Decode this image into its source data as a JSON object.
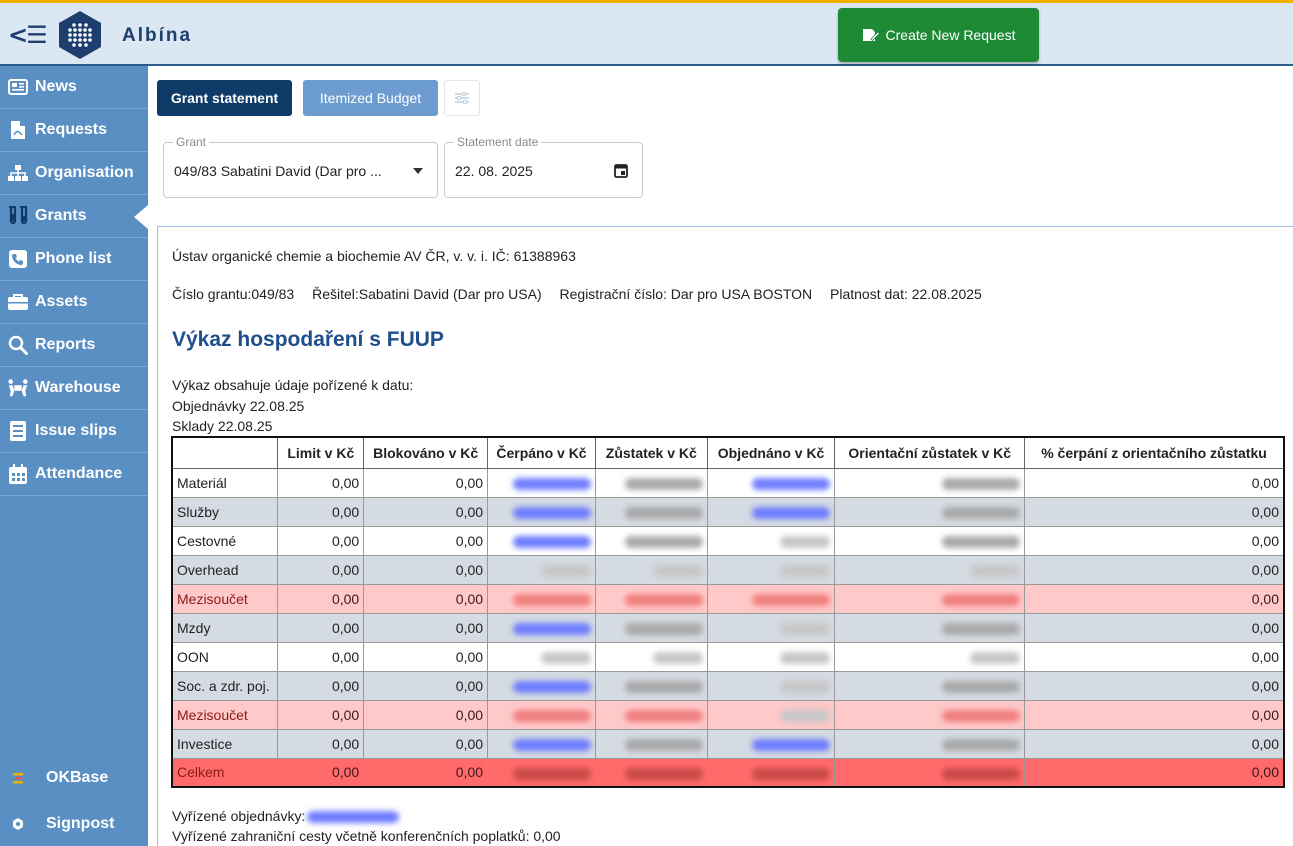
{
  "header": {
    "app_name": "Albína",
    "create_button": "Create New Request"
  },
  "sidebar": {
    "items": [
      {
        "label": "News",
        "icon": "newspaper-icon"
      },
      {
        "label": "Requests",
        "icon": "file-pdf-icon"
      },
      {
        "label": "Organisation",
        "icon": "sitemap-icon"
      },
      {
        "label": "Grants",
        "icon": "flask-icon",
        "active": true
      },
      {
        "label": "Phone list",
        "icon": "phone-icon"
      },
      {
        "label": "Assets",
        "icon": "briefcase-icon"
      },
      {
        "label": "Reports",
        "icon": "search-icon"
      },
      {
        "label": "Warehouse",
        "icon": "people-carry-icon"
      },
      {
        "label": "Issue slips",
        "icon": "list-icon"
      },
      {
        "label": "Attendance",
        "icon": "calendar-icon"
      }
    ],
    "bottom": [
      {
        "label": "OKBase",
        "icon": "okbase-icon"
      },
      {
        "label": "Signpost",
        "icon": "signpost-icon"
      }
    ]
  },
  "tabs": {
    "grant_statement": "Grant statement",
    "itemized_budget": "Itemized Budget"
  },
  "filters": {
    "grant_label": "Grant",
    "grant_value": "049/83 Sabatini David (Dar pro ...",
    "date_label": "Statement date",
    "date_value": "22. 08. 2025"
  },
  "report": {
    "institution": "Ústav organické chemie a biochemie AV ČR, v. v. i. IČ: 61388963",
    "grant_number": "Číslo grantu:049/83",
    "investigator": "Řešitel:Sabatini David (Dar pro USA)",
    "registration": "Registrační číslo: Dar pro USA BOSTON",
    "validity": "Platnost dat: 22.08.2025",
    "title": "Výkaz hospodaření s FUUP",
    "intro": "Výkaz obsahuje údaje pořízené k datu:",
    "orders_date": "Objednávky 22.08.25",
    "stock_date": "Sklady 22.08.25",
    "columns": [
      "",
      "Limit v Kč",
      "Blokováno v Kč",
      "Čerpáno v Kč",
      "Zůstatek v Kč",
      "Objednáno v Kč",
      "Orientační zůstatek v Kč",
      "% čerpání z orientačního zůstatku"
    ],
    "rows": [
      {
        "name": "Materiál",
        "limit": "0,00",
        "blocked": "0,00",
        "percent": "0,00",
        "style": "white"
      },
      {
        "name": "Služby",
        "limit": "0,00",
        "blocked": "0,00",
        "percent": "0,00",
        "style": "grey"
      },
      {
        "name": "Cestovné",
        "limit": "0,00",
        "blocked": "0,00",
        "percent": "0,00",
        "style": "white"
      },
      {
        "name": "Overhead",
        "limit": "0,00",
        "blocked": "0,00",
        "percent": "0,00",
        "style": "grey"
      },
      {
        "name": "Mezisoučet",
        "limit": "0,00",
        "blocked": "0,00",
        "percent": "0,00",
        "style": "pink"
      },
      {
        "name": "Mzdy",
        "limit": "0,00",
        "blocked": "0,00",
        "percent": "0,00",
        "style": "grey"
      },
      {
        "name": "OON",
        "limit": "0,00",
        "blocked": "0,00",
        "percent": "0,00",
        "style": "white"
      },
      {
        "name": "Soc. a zdr. poj.",
        "limit": "0,00",
        "blocked": "0,00",
        "percent": "0,00",
        "style": "grey"
      },
      {
        "name": "Mezisoučet",
        "limit": "0,00",
        "blocked": "0,00",
        "percent": "0,00",
        "style": "pink"
      },
      {
        "name": "Investice",
        "limit": "0,00",
        "blocked": "0,00",
        "percent": "0,00",
        "style": "grey"
      },
      {
        "name": "Celkem",
        "limit": "0,00",
        "blocked": "0,00",
        "percent": "0,00",
        "style": "red"
      }
    ],
    "footer_orders": "Vyřízené objednávky:",
    "footer_trips": "Vyřízené zahraniční cesty včetně konferenčních poplatků: 0,00"
  },
  "colors": {
    "accent_top": "#f2b100",
    "header_bg": "#dbe7f2",
    "sidebar_bg": "#5a8fc4",
    "primary_dark": "#0f3b68",
    "create_green": "#1f8a36",
    "title_blue": "#1f4e8c",
    "row_pink": "#ffc9c9",
    "row_red": "#ff6b6b",
    "row_grey": "#d5dbe2"
  }
}
